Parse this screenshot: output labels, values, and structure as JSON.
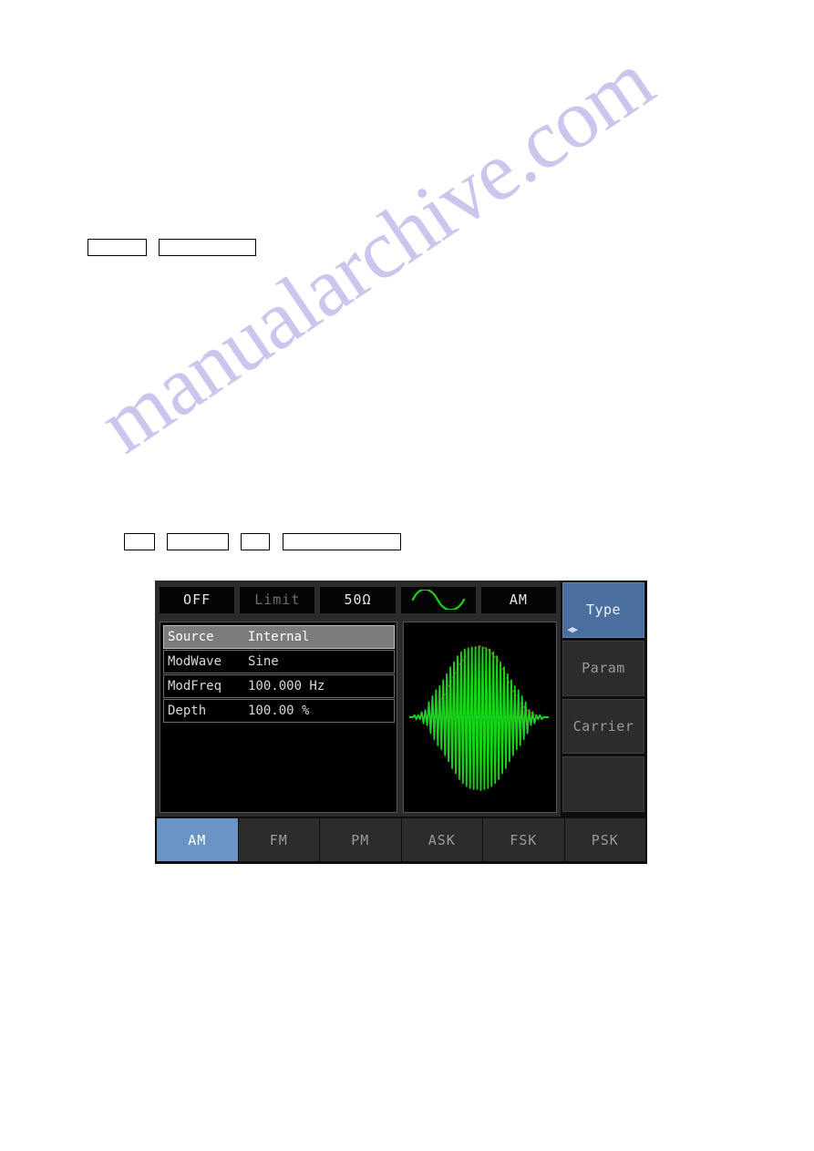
{
  "watermark": {
    "text": "manualarchive.com"
  },
  "annotation_boxes": {
    "row1": [
      {
        "name": "blank-key-box-1",
        "label": ""
      },
      {
        "name": "blank-key-box-2",
        "label": ""
      }
    ],
    "row2": [
      {
        "name": "blank-key-box-3",
        "label": ""
      },
      {
        "name": "blank-key-box-4",
        "label": ""
      },
      {
        "name": "blank-key-box-5",
        "label": ""
      },
      {
        "name": "blank-key-box-6",
        "label": ""
      }
    ]
  },
  "display": {
    "statusbar": {
      "output_state": "OFF",
      "limit": "Limit",
      "impedance": "50Ω",
      "waveform_icon": "sine-wave-icon",
      "modulation": "AM"
    },
    "parameters": [
      {
        "label": "Source",
        "value": "Internal",
        "selected": true
      },
      {
        "label": "ModWave",
        "value": "Sine",
        "selected": false
      },
      {
        "label": "ModFreq",
        "value": "100.000 Hz",
        "selected": false
      },
      {
        "label": "Depth",
        "value": "100.00 %",
        "selected": false
      }
    ],
    "softkeys": [
      {
        "label": "Type",
        "active": true,
        "arrows": "◀▶"
      },
      {
        "label": "Param",
        "active": false,
        "arrows": ""
      },
      {
        "label": "Carrier",
        "active": false,
        "arrows": ""
      },
      {
        "label": "",
        "active": false,
        "arrows": ""
      }
    ],
    "tabs": [
      {
        "label": "AM",
        "active": true
      },
      {
        "label": "FM",
        "active": false
      },
      {
        "label": "PM",
        "active": false
      },
      {
        "label": "ASK",
        "active": false
      },
      {
        "label": "FSK",
        "active": false
      },
      {
        "label": "PSK",
        "active": false
      }
    ],
    "waveform_preview": {
      "carrier_color": "#18d418",
      "envelope_color": "#c22020",
      "baseline_color": "#d8d8d8",
      "description": "AM modulated sine carrier with sine envelope"
    }
  }
}
